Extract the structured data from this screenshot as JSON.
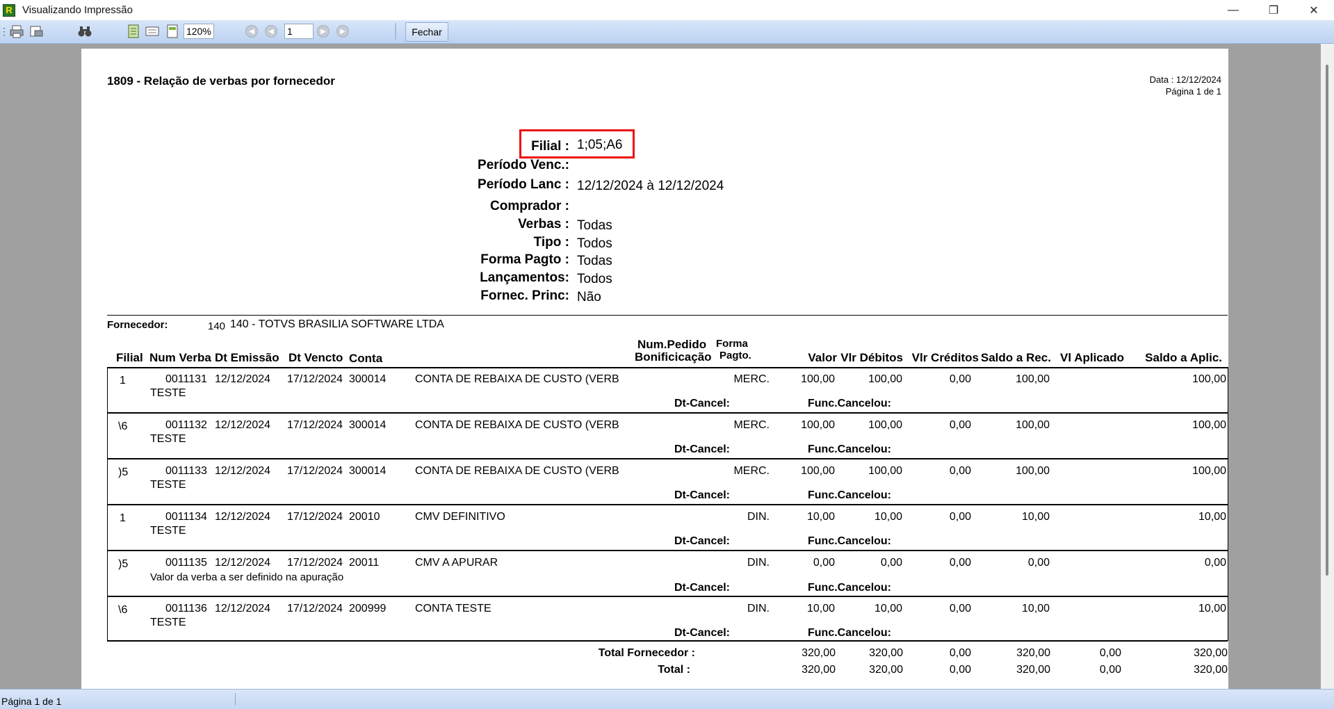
{
  "window": {
    "title": "Visualizando Impressão",
    "controls": [
      "—",
      "❐",
      "✕"
    ]
  },
  "toolbar": {
    "zoom": "120%",
    "page_number": "1",
    "close_label": "Fechar"
  },
  "status": {
    "text": "Página 1 de 1"
  },
  "report": {
    "title": "1809 - Relação de verbas por fornecedor",
    "date_line": "Data : 12/12/2024",
    "page_line": "Página 1 de 1",
    "filters": [
      {
        "label": "Filial :",
        "value": "1;05;A6"
      },
      {
        "label": "Período Venc.:",
        "value": ""
      },
      {
        "label": "Período Lanc :",
        "value": "12/12/2024 à 12/12/2024"
      },
      {
        "label": "Comprador :",
        "value": ""
      },
      {
        "label": "Verbas :",
        "value": "Todas"
      },
      {
        "label": "Tipo :",
        "value": "Todos"
      },
      {
        "label": "Forma Pagto :",
        "value": "Todas"
      },
      {
        "label": "Lançamentos:",
        "value": "Todos"
      },
      {
        "label": "Fornec. Princ:",
        "value": "Não"
      }
    ],
    "supplier": {
      "label": "Fornecedor:",
      "code": "140",
      "name": "140 - TOTVS BRASILIA SOFTWARE LTDA"
    },
    "columns": {
      "filial": "Filial",
      "num_verba": "Num Verba",
      "dt_emissao": "Dt Emissão",
      "dt_vencto": "Dt Vencto",
      "conta": "Conta",
      "num_pedido_1": "Num.Pedido",
      "num_pedido_2": "Bonificicação",
      "forma_1": "Forma",
      "forma_2": "Pagto.",
      "valor": "Valor",
      "vlr_debitos": "Vlr Débitos",
      "vlr_creditos": "Vlr Créditos",
      "saldo_rec": "Saldo a Rec.",
      "vl_aplicado": "Vl Aplicado",
      "saldo_aplic": "Saldo a Aplic."
    },
    "cancel_label": "Dt-Cancel:",
    "cancelled_by_label": "Func.Cancelou:",
    "rows": [
      {
        "filial": "1",
        "num_verba": "0011131",
        "dt_emissao": "12/12/2024",
        "dt_vencto": "17/12/2024",
        "conta": "300014",
        "conta_desc": "CONTA DE REBAIXA DE CUSTO (VERB",
        "forma": "MERC.",
        "valor": "100,00",
        "debitos": "100,00",
        "creditos": "0,00",
        "saldo_rec": "100,00",
        "saldo_aplic": "100,00",
        "desc": "TESTE"
      },
      {
        "filial": "\\6",
        "num_verba": "0011132",
        "dt_emissao": "12/12/2024",
        "dt_vencto": "17/12/2024",
        "conta": "300014",
        "conta_desc": "CONTA DE REBAIXA DE CUSTO (VERB",
        "forma": "MERC.",
        "valor": "100,00",
        "debitos": "100,00",
        "creditos": "0,00",
        "saldo_rec": "100,00",
        "saldo_aplic": "100,00",
        "desc": "TESTE"
      },
      {
        "filial": ")5",
        "num_verba": "0011133",
        "dt_emissao": "12/12/2024",
        "dt_vencto": "17/12/2024",
        "conta": "300014",
        "conta_desc": "CONTA DE REBAIXA DE CUSTO (VERB",
        "forma": "MERC.",
        "valor": "100,00",
        "debitos": "100,00",
        "creditos": "0,00",
        "saldo_rec": "100,00",
        "saldo_aplic": "100,00",
        "desc": "TESTE"
      },
      {
        "filial": "1",
        "num_verba": "0011134",
        "dt_emissao": "12/12/2024",
        "dt_vencto": "17/12/2024",
        "conta": "20010",
        "conta_desc": "CMV DEFINITIVO",
        "forma": "DIN.",
        "valor": "10,00",
        "debitos": "10,00",
        "creditos": "0,00",
        "saldo_rec": "10,00",
        "saldo_aplic": "10,00",
        "desc": "TESTE"
      },
      {
        "filial": ")5",
        "num_verba": "0011135",
        "dt_emissao": "12/12/2024",
        "dt_vencto": "17/12/2024",
        "conta": "20011",
        "conta_desc": "CMV A APURAR",
        "forma": "DIN.",
        "valor": "0,00",
        "debitos": "0,00",
        "creditos": "0,00",
        "saldo_rec": "0,00",
        "saldo_aplic": "0,00",
        "desc": "Valor da verba a ser definido na apuração"
      },
      {
        "filial": "\\6",
        "num_verba": "0011136",
        "dt_emissao": "12/12/2024",
        "dt_vencto": "17/12/2024",
        "conta": "200999",
        "conta_desc": "CONTA TESTE",
        "forma": "DIN.",
        "valor": "10,00",
        "debitos": "10,00",
        "creditos": "0,00",
        "saldo_rec": "10,00",
        "saldo_aplic": "10,00",
        "desc": "TESTE"
      }
    ],
    "totals": [
      {
        "label": "Total Fornecedor :",
        "valor": "320,00",
        "debitos": "320,00",
        "creditos": "0,00",
        "saldo_rec": "320,00",
        "vl_aplicado": "0,00",
        "saldo_aplic": "320,00"
      },
      {
        "label": "Total :",
        "valor": "320,00",
        "debitos": "320,00",
        "creditos": "0,00",
        "saldo_rec": "320,00",
        "vl_aplicado": "0,00",
        "saldo_aplic": "320,00"
      }
    ]
  }
}
